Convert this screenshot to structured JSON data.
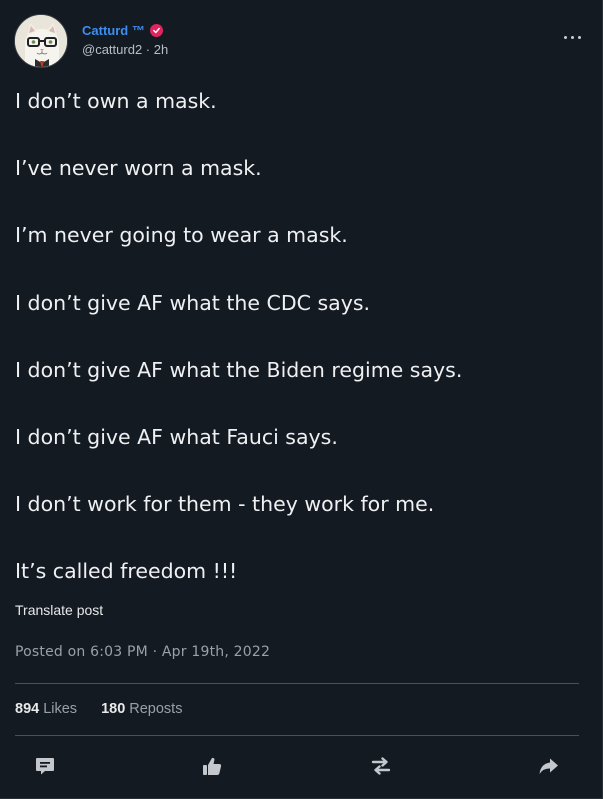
{
  "post": {
    "author": {
      "display_name": "Catturd ™",
      "handle": "@catturd2",
      "time_ago": "2h"
    },
    "paragraphs": [
      "I don’t own a mask.",
      "I’ve never worn a mask.",
      "I’m never going to wear a mask.",
      "I don’t give AF what the CDC says.",
      "I don’t give AF what the Biden regime says.",
      "I don’t give AF what Fauci says.",
      "I don’t work for them - they work for me.",
      "It’s called freedom !!!"
    ],
    "translate_label": "Translate post",
    "posted_text": "Posted on 6:03 PM · Apr 19th, 2022",
    "stats": {
      "likes_count": "894",
      "likes_label": "Likes",
      "reposts_count": "180",
      "reposts_label": "Reposts"
    }
  },
  "icons": {
    "verified": "verified-badge-icon",
    "more": "more-options-icon",
    "reply": "comment-icon",
    "like": "thumbs-up-icon",
    "repost": "repost-icon",
    "share": "share-icon"
  },
  "colors": {
    "background": "#141a22",
    "name_accent": "#3d8ef0",
    "badge": "#e0245e",
    "text": "#eef0f2",
    "muted": "#9aa0a8"
  }
}
